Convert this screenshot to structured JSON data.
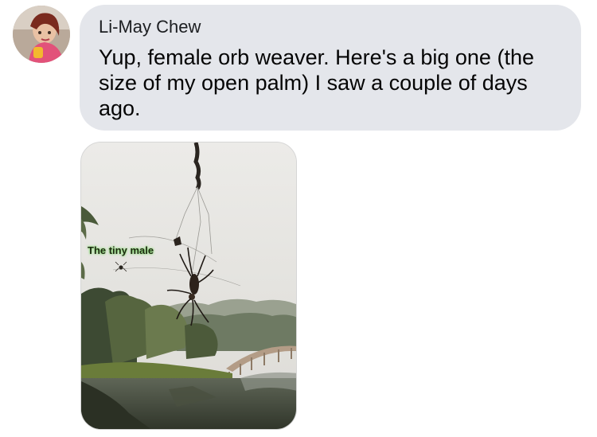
{
  "comment": {
    "author": "Li-May Chew",
    "text": "Yup, female orb weaver. Here's a big one (the size of my open palm) I saw a couple of days ago.",
    "bubble_color": "#e4e6eb"
  },
  "attachment": {
    "caption_overlay": "The tiny male"
  }
}
